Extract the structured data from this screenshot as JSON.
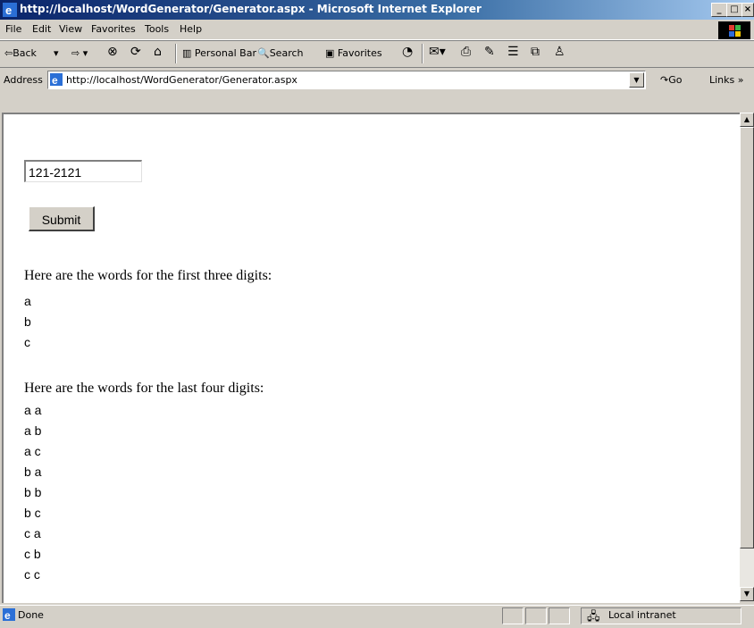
{
  "window": {
    "title": "http://localhost/WordGenerator/Generator.aspx - Microsoft Internet Explorer"
  },
  "menu": [
    "File",
    "Edit",
    "View",
    "Favorites",
    "Tools",
    "Help"
  ],
  "toolbar": {
    "back": "⇦Back",
    "personal_bar": "Personal Bar",
    "search": "Search",
    "favorites": "Favorites"
  },
  "address": {
    "label": "Address",
    "url": "http://localhost/WordGenerator/Generator.aspx",
    "go": "Go",
    "links": "Links"
  },
  "form": {
    "input_value": "121-2121",
    "submit_label": "Submit"
  },
  "results": {
    "first_heading": "Here are the words for the first three digits:",
    "first_words": [
      "a",
      "b",
      "c"
    ],
    "last_heading": "Here are the words for the last four digits:",
    "last_words": [
      "a a",
      "a b",
      "a c",
      "b a",
      "b b",
      "b c",
      "c a",
      "c b",
      "c c"
    ]
  },
  "status": {
    "text": "Done",
    "zone": "Local intranet"
  }
}
